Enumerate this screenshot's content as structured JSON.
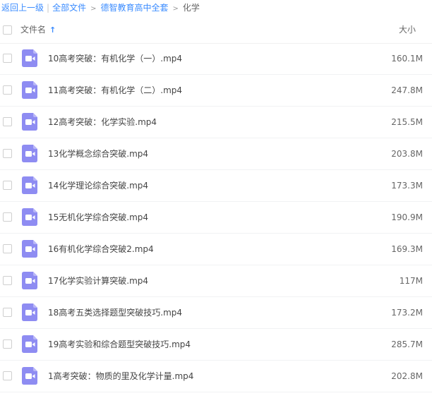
{
  "breadcrumb": {
    "back": "返回上一级",
    "all_files": "全部文件",
    "parent_folder": "德智教育高中全套",
    "current": "化学"
  },
  "list_header": {
    "name_label": "文件名",
    "size_label": "大小",
    "sort_icon": "sort-up-arrow"
  },
  "colors": {
    "link": "#3b8cff",
    "video_icon": "#8e8cf2"
  },
  "files": [
    {
      "name": "10高考突破：有机化学（一）.mp4",
      "size": "160.1M",
      "icon": "video-file-icon"
    },
    {
      "name": "11高考突破：有机化学（二）.mp4",
      "size": "247.8M",
      "icon": "video-file-icon"
    },
    {
      "name": "12高考突破：化学实验.mp4",
      "size": "215.5M",
      "icon": "video-file-icon"
    },
    {
      "name": "13化学概念综合突破.mp4",
      "size": "203.8M",
      "icon": "video-file-icon"
    },
    {
      "name": "14化学理论综合突破.mp4",
      "size": "173.3M",
      "icon": "video-file-icon"
    },
    {
      "name": "15无机化学综合突破.mp4",
      "size": "190.9M",
      "icon": "video-file-icon"
    },
    {
      "name": "16有机化学综合突破2.mp4",
      "size": "169.3M",
      "icon": "video-file-icon"
    },
    {
      "name": "17化学实验计算突破.mp4",
      "size": "117M",
      "icon": "video-file-icon"
    },
    {
      "name": "18高考五类选择题型突破技巧.mp4",
      "size": "173.2M",
      "icon": "video-file-icon"
    },
    {
      "name": "19高考实验和综合题型突破技巧.mp4",
      "size": "285.7M",
      "icon": "video-file-icon"
    },
    {
      "name": "1高考突破：物质的里及化学计量.mp4",
      "size": "202.8M",
      "icon": "video-file-icon"
    }
  ]
}
